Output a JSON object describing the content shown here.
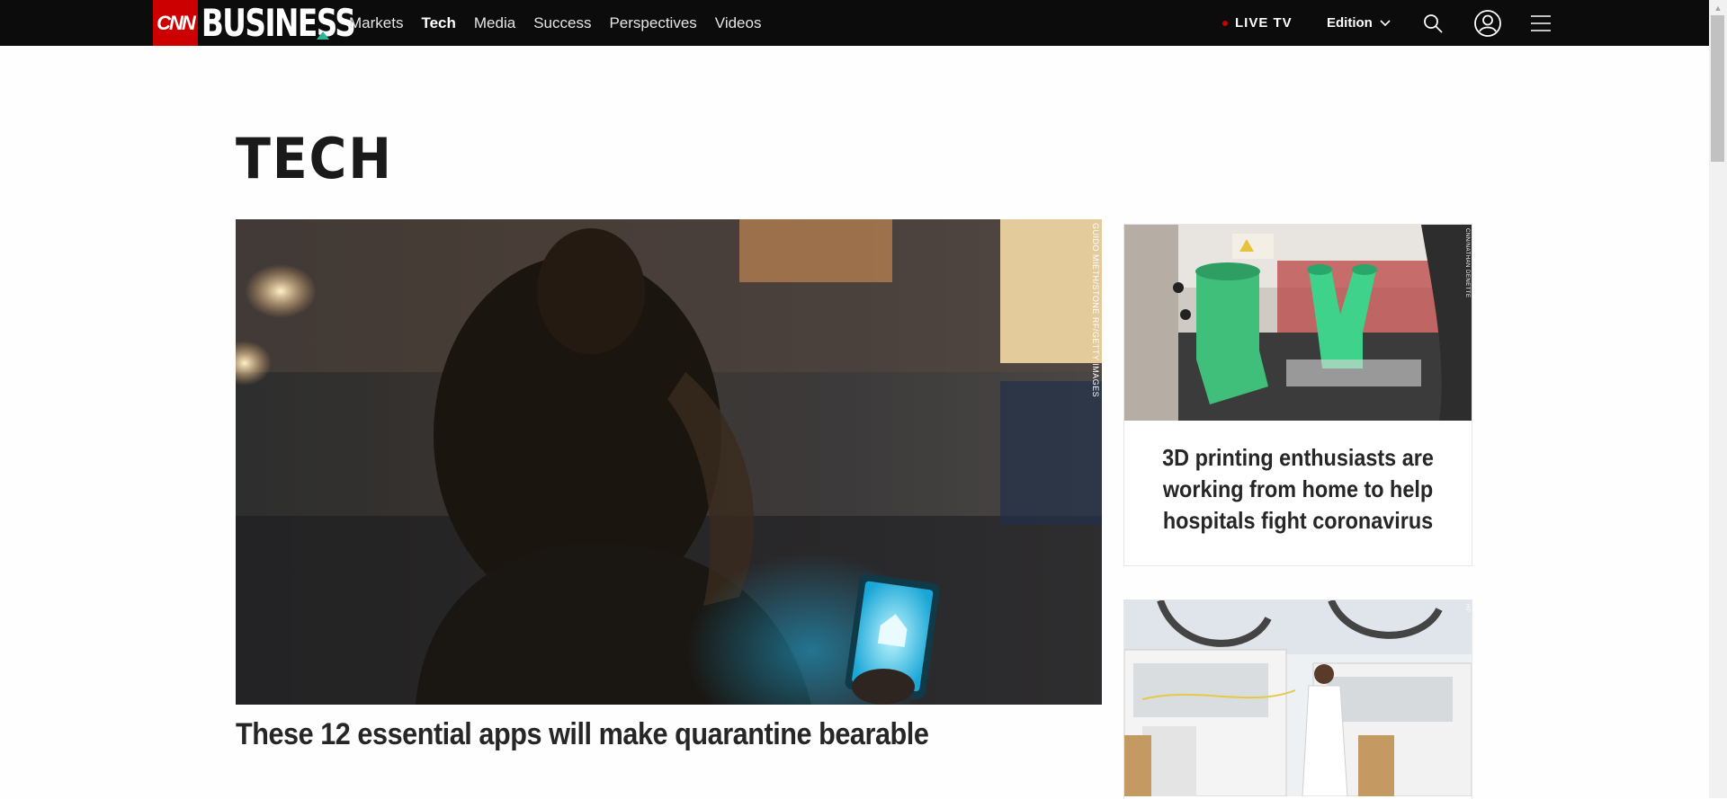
{
  "header": {
    "logo_cnn": "CNN",
    "logo_business": "BUSINESS",
    "nav": [
      "Markets",
      "Tech",
      "Media",
      "Success",
      "Perspectives",
      "Videos"
    ],
    "active_nav": "Tech",
    "live_tv": "LIVE TV",
    "edition": "Edition",
    "icons": [
      "search-icon",
      "account-icon",
      "menu-icon"
    ]
  },
  "page": {
    "section_title": "TECH"
  },
  "hero": {
    "credit": "GUIDO MIETH/STONE RF/GETTY IMAGES",
    "headline": "These 12 essential apps will make quarantine bearable"
  },
  "cards": [
    {
      "credit": "CNN/NATHAN DENETTE",
      "headline": "3D printing enthusiasts are working from home to help hospitals fight coronavirus"
    },
    {
      "credit": "HP",
      "headline": ""
    }
  ],
  "colors": {
    "topbar": "#0c0c0c",
    "cnn_red": "#cc0000",
    "accent_teal": "#2bb89a",
    "text": "#262626"
  }
}
